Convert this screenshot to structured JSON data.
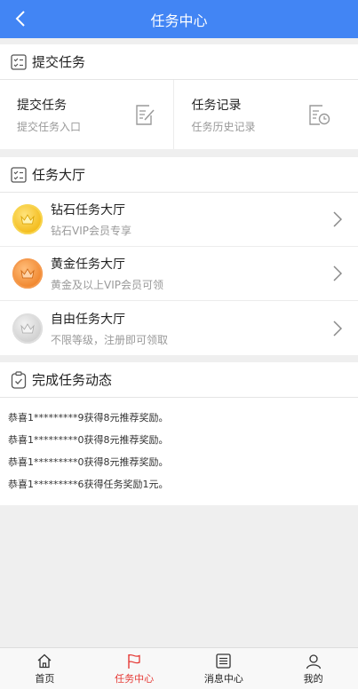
{
  "header": {
    "title": "任务中心"
  },
  "submit_section": {
    "title": "提交任务",
    "items": [
      {
        "title": "提交任务",
        "subtitle": "提交任务入口",
        "icon": "edit-doc-icon"
      },
      {
        "title": "任务记录",
        "subtitle": "任务历史记录",
        "icon": "history-doc-icon"
      }
    ]
  },
  "hall_section": {
    "title": "任务大厅",
    "items": [
      {
        "title": "钻石任务大厅",
        "subtitle": "钻石VIP会员专享",
        "medal": "gold"
      },
      {
        "title": "黄金任务大厅",
        "subtitle": "黄金及以上VIP会员可领",
        "medal": "bronze"
      },
      {
        "title": "自由任务大厅",
        "subtitle": "不限等级，注册即可领取",
        "medal": "silver"
      }
    ]
  },
  "feed_section": {
    "title": "完成任务动态",
    "items": [
      "恭喜1*********9获得8元推荐奖励。",
      "恭喜1*********0获得8元推荐奖励。",
      "恭喜1*********0获得8元推荐奖励。",
      "恭喜1*********6获得任务奖励1元。"
    ]
  },
  "tabbar": {
    "items": [
      {
        "label": "首页",
        "icon": "home-icon"
      },
      {
        "label": "任务中心",
        "icon": "flag-icon",
        "active": true
      },
      {
        "label": "消息中心",
        "icon": "list-icon"
      },
      {
        "label": "我的",
        "icon": "user-icon"
      }
    ]
  },
  "colors": {
    "header_bg": "#4285f4",
    "active_tab": "#e53935"
  }
}
